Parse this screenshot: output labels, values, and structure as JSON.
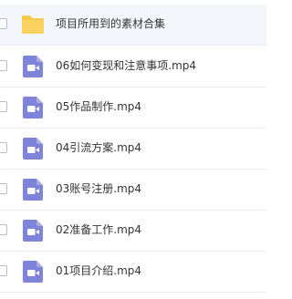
{
  "files": [
    {
      "name": "项目所用到的素材合集",
      "type": "folder",
      "icon": "folder-icon"
    },
    {
      "name": "06如何变现和注意事项.mp4",
      "type": "video",
      "icon": "video-file-icon"
    },
    {
      "name": "05作品制作.mp4",
      "type": "video",
      "icon": "video-file-icon"
    },
    {
      "name": "04引流方案.mp4",
      "type": "video",
      "icon": "video-file-icon"
    },
    {
      "name": "03账号注册.mp4",
      "type": "video",
      "icon": "video-file-icon"
    },
    {
      "name": "02准备工作.mp4",
      "type": "video",
      "icon": "video-file-icon"
    },
    {
      "name": "01项目介绍.mp4",
      "type": "video",
      "icon": "video-file-icon"
    }
  ],
  "colors": {
    "folder": "#f7c948",
    "video": "#7e84d9",
    "folder_row_bg": "#f3f7fc",
    "divider": "#e9edf3"
  }
}
